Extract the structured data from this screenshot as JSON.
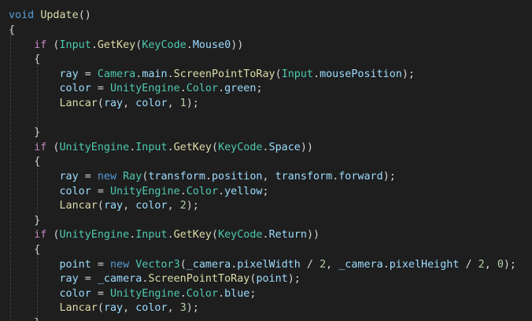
{
  "theme": {
    "background": "#1e1e1e",
    "keyword": "#569cd6",
    "control": "#c586c0",
    "function": "#dcdcaa",
    "type": "#4ec9b0",
    "variable": "#9cdcfe",
    "number": "#b5cea8",
    "punctuation": "#d4d4d4"
  },
  "code": {
    "lines": [
      [],
      [
        [
          "kw",
          "void"
        ],
        [
          "plain",
          " "
        ],
        [
          "fn",
          "Update"
        ],
        [
          "punc",
          "()"
        ]
      ],
      [
        [
          "punc",
          "{"
        ]
      ],
      [
        [
          "plain",
          "    "
        ],
        [
          "ctl",
          "if"
        ],
        [
          "punc",
          " ("
        ],
        [
          "type",
          "Input"
        ],
        [
          "punc",
          "."
        ],
        [
          "fn",
          "GetKey"
        ],
        [
          "punc",
          "("
        ],
        [
          "type",
          "KeyCode"
        ],
        [
          "punc",
          "."
        ],
        [
          "var",
          "Mouse0"
        ],
        [
          "punc",
          "))"
        ]
      ],
      [
        [
          "plain",
          "    "
        ],
        [
          "punc",
          "{"
        ]
      ],
      [
        [
          "plain",
          "        "
        ],
        [
          "var",
          "ray"
        ],
        [
          "punc",
          " = "
        ],
        [
          "type",
          "Camera"
        ],
        [
          "punc",
          "."
        ],
        [
          "var",
          "main"
        ],
        [
          "punc",
          "."
        ],
        [
          "fn",
          "ScreenPointToRay"
        ],
        [
          "punc",
          "("
        ],
        [
          "type",
          "Input"
        ],
        [
          "punc",
          "."
        ],
        [
          "var",
          "mousePosition"
        ],
        [
          "punc",
          ");"
        ]
      ],
      [
        [
          "plain",
          "        "
        ],
        [
          "var",
          "color"
        ],
        [
          "punc",
          " = "
        ],
        [
          "type",
          "UnityEngine"
        ],
        [
          "punc",
          "."
        ],
        [
          "type",
          "Color"
        ],
        [
          "punc",
          "."
        ],
        [
          "var",
          "green"
        ],
        [
          "punc",
          ";"
        ]
      ],
      [
        [
          "plain",
          "        "
        ],
        [
          "fn",
          "Lancar"
        ],
        [
          "punc",
          "("
        ],
        [
          "var",
          "ray"
        ],
        [
          "punc",
          ", "
        ],
        [
          "var",
          "color"
        ],
        [
          "punc",
          ", "
        ],
        [
          "num",
          "1"
        ],
        [
          "punc",
          ");"
        ]
      ],
      [],
      [
        [
          "plain",
          "    "
        ],
        [
          "punc",
          "}"
        ]
      ],
      [
        [
          "plain",
          "    "
        ],
        [
          "ctl",
          "if"
        ],
        [
          "punc",
          " ("
        ],
        [
          "type",
          "UnityEngine"
        ],
        [
          "punc",
          "."
        ],
        [
          "type",
          "Input"
        ],
        [
          "punc",
          "."
        ],
        [
          "fn",
          "GetKey"
        ],
        [
          "punc",
          "("
        ],
        [
          "type",
          "KeyCode"
        ],
        [
          "punc",
          "."
        ],
        [
          "var",
          "Space"
        ],
        [
          "punc",
          "))"
        ]
      ],
      [
        [
          "plain",
          "    "
        ],
        [
          "punc",
          "{"
        ]
      ],
      [
        [
          "plain",
          "        "
        ],
        [
          "var",
          "ray"
        ],
        [
          "punc",
          " = "
        ],
        [
          "kw",
          "new"
        ],
        [
          "plain",
          " "
        ],
        [
          "type",
          "Ray"
        ],
        [
          "punc",
          "("
        ],
        [
          "var",
          "transform"
        ],
        [
          "punc",
          "."
        ],
        [
          "var",
          "position"
        ],
        [
          "punc",
          ", "
        ],
        [
          "var",
          "transform"
        ],
        [
          "punc",
          "."
        ],
        [
          "var",
          "forward"
        ],
        [
          "punc",
          ");"
        ]
      ],
      [
        [
          "plain",
          "        "
        ],
        [
          "var",
          "color"
        ],
        [
          "punc",
          " = "
        ],
        [
          "type",
          "UnityEngine"
        ],
        [
          "punc",
          "."
        ],
        [
          "type",
          "Color"
        ],
        [
          "punc",
          "."
        ],
        [
          "var",
          "yellow"
        ],
        [
          "punc",
          ";"
        ]
      ],
      [
        [
          "plain",
          "        "
        ],
        [
          "fn",
          "Lancar"
        ],
        [
          "punc",
          "("
        ],
        [
          "var",
          "ray"
        ],
        [
          "punc",
          ", "
        ],
        [
          "var",
          "color"
        ],
        [
          "punc",
          ", "
        ],
        [
          "num",
          "2"
        ],
        [
          "punc",
          ");"
        ]
      ],
      [
        [
          "plain",
          "    "
        ],
        [
          "punc",
          "}"
        ]
      ],
      [
        [
          "plain",
          "    "
        ],
        [
          "ctl",
          "if"
        ],
        [
          "punc",
          " ("
        ],
        [
          "type",
          "UnityEngine"
        ],
        [
          "punc",
          "."
        ],
        [
          "type",
          "Input"
        ],
        [
          "punc",
          "."
        ],
        [
          "fn",
          "GetKey"
        ],
        [
          "punc",
          "("
        ],
        [
          "type",
          "KeyCode"
        ],
        [
          "punc",
          "."
        ],
        [
          "var",
          "Return"
        ],
        [
          "punc",
          "))"
        ]
      ],
      [
        [
          "plain",
          "    "
        ],
        [
          "punc",
          "{"
        ]
      ],
      [
        [
          "plain",
          "        "
        ],
        [
          "var",
          "point"
        ],
        [
          "punc",
          " = "
        ],
        [
          "kw",
          "new"
        ],
        [
          "plain",
          " "
        ],
        [
          "type",
          "Vector3"
        ],
        [
          "punc",
          "("
        ],
        [
          "var",
          "_camera"
        ],
        [
          "punc",
          "."
        ],
        [
          "var",
          "pixelWidth"
        ],
        [
          "punc",
          " / "
        ],
        [
          "num",
          "2"
        ],
        [
          "punc",
          ", "
        ],
        [
          "var",
          "_camera"
        ],
        [
          "punc",
          "."
        ],
        [
          "var",
          "pixelHeight"
        ],
        [
          "punc",
          " / "
        ],
        [
          "num",
          "2"
        ],
        [
          "punc",
          ", "
        ],
        [
          "num",
          "0"
        ],
        [
          "punc",
          ");"
        ]
      ],
      [
        [
          "plain",
          "        "
        ],
        [
          "var",
          "ray"
        ],
        [
          "punc",
          " = "
        ],
        [
          "var",
          "_camera"
        ],
        [
          "punc",
          "."
        ],
        [
          "fn",
          "ScreenPointToRay"
        ],
        [
          "punc",
          "("
        ],
        [
          "var",
          "point"
        ],
        [
          "punc",
          ");"
        ]
      ],
      [
        [
          "plain",
          "        "
        ],
        [
          "var",
          "color"
        ],
        [
          "punc",
          " = "
        ],
        [
          "type",
          "UnityEngine"
        ],
        [
          "punc",
          "."
        ],
        [
          "type",
          "Color"
        ],
        [
          "punc",
          "."
        ],
        [
          "var",
          "blue"
        ],
        [
          "punc",
          ";"
        ]
      ],
      [
        [
          "plain",
          "        "
        ],
        [
          "fn",
          "Lancar"
        ],
        [
          "punc",
          "("
        ],
        [
          "var",
          "ray"
        ],
        [
          "punc",
          ", "
        ],
        [
          "var",
          "color"
        ],
        [
          "punc",
          ", "
        ],
        [
          "num",
          "3"
        ],
        [
          "punc",
          ");"
        ]
      ],
      [
        [
          "plain",
          "    "
        ],
        [
          "punc",
          "}"
        ]
      ]
    ]
  }
}
